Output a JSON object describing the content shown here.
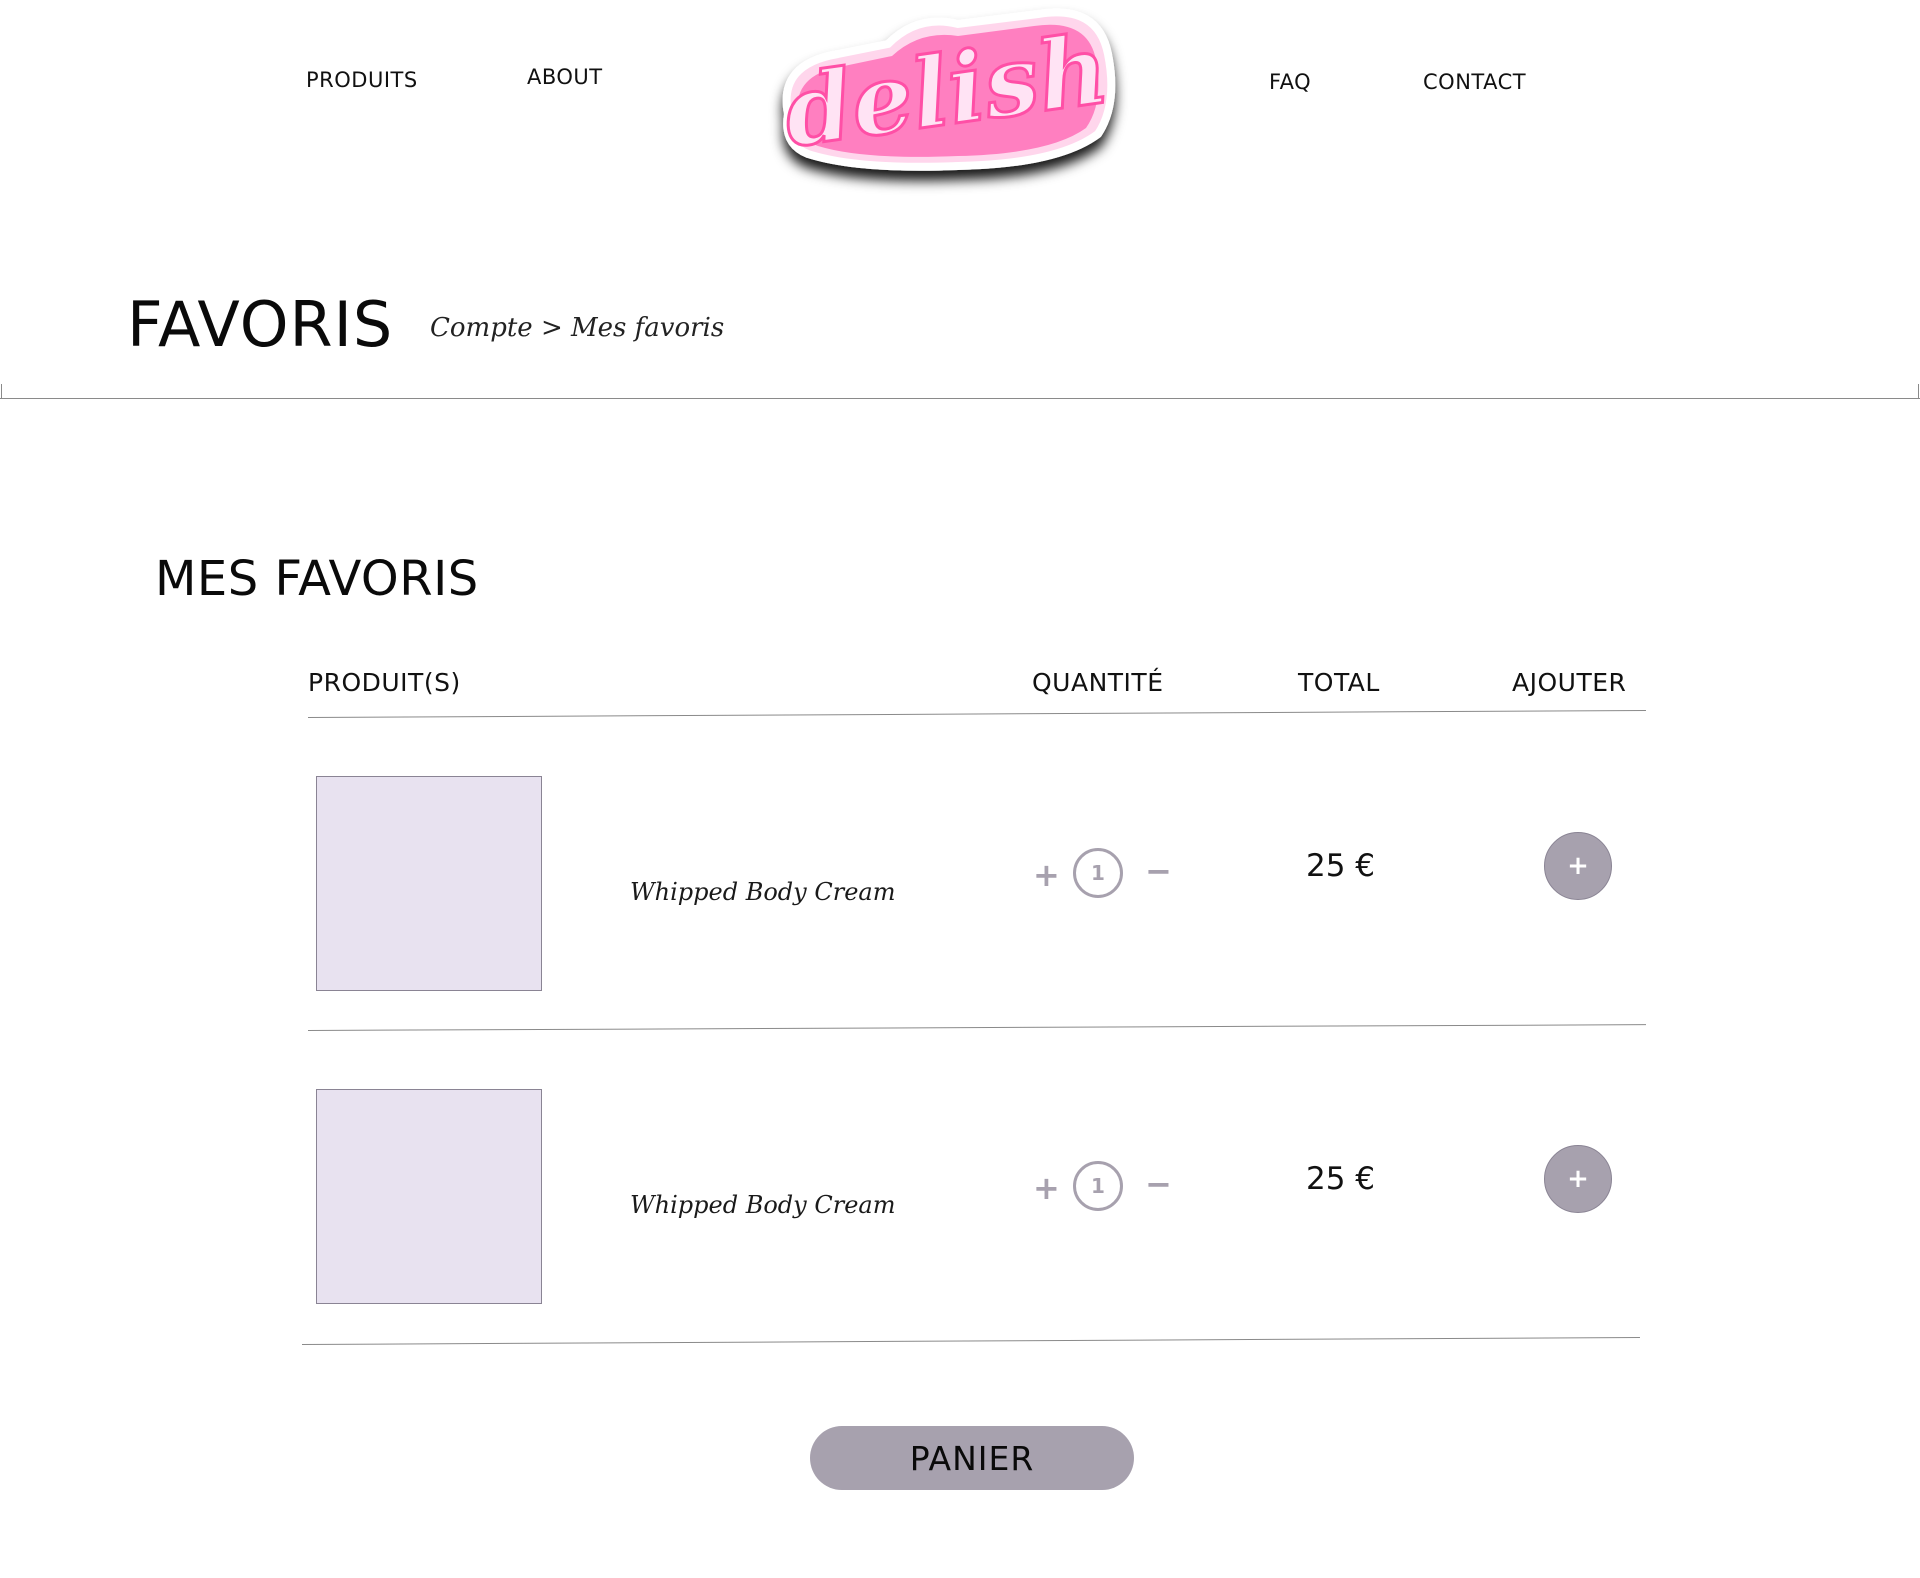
{
  "nav": {
    "left": [
      "PRODUITS",
      "ABOUT"
    ],
    "right": [
      "FAQ",
      "CONTACT"
    ]
  },
  "logo": {
    "text": "delish"
  },
  "header": {
    "title": "FAVORIS",
    "breadcrumb": [
      "Compte",
      ">",
      "Mes favoris"
    ]
  },
  "section_title": "MES FAVORIS",
  "table": {
    "columns": [
      "PRODUIT(S)",
      "QUANTITÉ",
      "TOTAL",
      "AJOUTER"
    ],
    "rows": [
      {
        "name": "Whipped Body Cream",
        "quantity": "1",
        "total": "25 €"
      },
      {
        "name": "Whipped Body Cream",
        "quantity": "1",
        "total": "25 €"
      }
    ]
  },
  "icons": {
    "qty_plus": "plus-icon",
    "qty_minus": "minus-icon",
    "add": "plus-icon"
  },
  "symbols": {
    "plus": "+",
    "minus": "−"
  },
  "cta": {
    "panier_label": "PANIER"
  },
  "colors": {
    "accent": "#a7a1ae",
    "thumb_bg": "#e8e2f0",
    "logo_pink": "#ff6fb5"
  }
}
